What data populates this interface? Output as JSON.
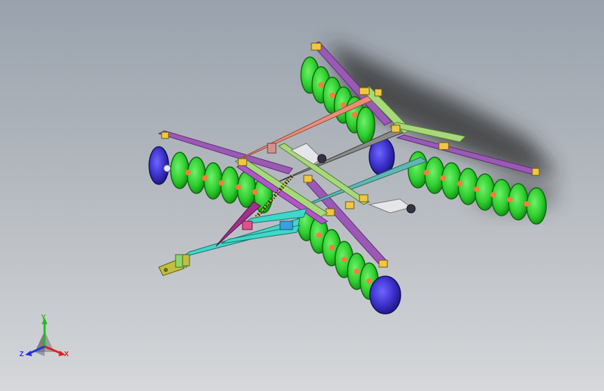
{
  "viewport": {
    "background_top": "#99a2ad",
    "background_bottom": "#d5d7da"
  },
  "model": {
    "colors": {
      "gangs_frame": "#9b59b6",
      "disc_green": "#2fcf2f",
      "disc_blue": "#3a2fc8",
      "spool_orange": "#ff7a3d",
      "crossbar_salmon": "#ea8d78",
      "crossbar_gray": "#8a8a8a",
      "crossbar_teal": "#5fb7b0",
      "bracket_yellow": "#e0c040",
      "frame_green": "#a7d87a",
      "tongue_cyan": "#3fd7c9",
      "hitch_olive": "#c0c040"
    }
  },
  "triad": {
    "axis_y": "Y",
    "axis_x": "X",
    "axis_z": "Z",
    "color_y": "#22bb22",
    "color_x": "#dd2222",
    "color_z": "#2233dd"
  }
}
